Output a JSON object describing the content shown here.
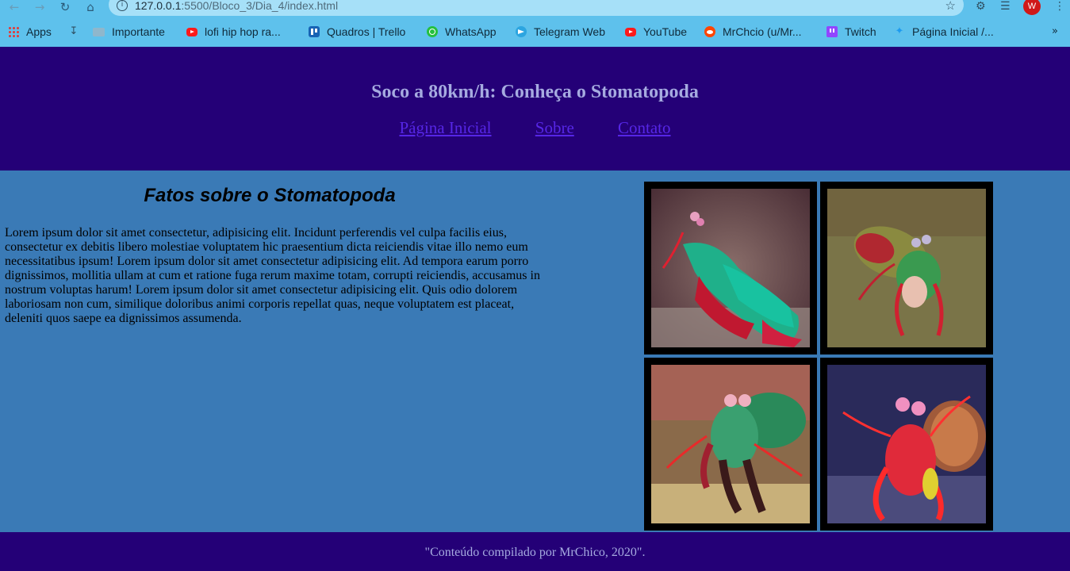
{
  "browser": {
    "url_host": "127.0.0.1",
    "url_rest": ":5500/Bloco_3/Dia_4/index.html",
    "profile_initial": "W",
    "bookmarks": [
      {
        "label": "Apps",
        "icon": "apps-grid-icon"
      },
      {
        "label": "",
        "icon": "download-icon"
      },
      {
        "label": "Importante",
        "icon": "folder-icon"
      },
      {
        "label": "lofi hip hop ra...",
        "icon": "youtube-icon"
      },
      {
        "label": "Quadros | Trello",
        "icon": "trello-icon"
      },
      {
        "label": "WhatsApp",
        "icon": "whatsapp-icon"
      },
      {
        "label": "Telegram Web",
        "icon": "telegram-icon"
      },
      {
        "label": "YouTube",
        "icon": "youtube-icon"
      },
      {
        "label": "MrChcio (u/Mr...",
        "icon": "reddit-icon"
      },
      {
        "label": "Twitch",
        "icon": "twitch-icon"
      },
      {
        "label": "Página Inicial /...",
        "icon": "twitter-icon"
      }
    ]
  },
  "header": {
    "title": "Soco a 80km/h: Conheça o Stomatopoda",
    "nav": [
      "Página Inicial",
      "Sobre",
      "Contato"
    ]
  },
  "main": {
    "heading": "Fatos sobre o Stomatopoda",
    "body": "Lorem ipsum dolor sit amet consectetur, adipisicing elit. Incidunt perferendis vel culpa facilis eius, consectetur ex debitis libero molestiae voluptatem hic praesentium dicta reiciendis vitae illo nemo eum necessitatibus ipsum! Lorem ipsum dolor sit amet consectetur adipisicing elit. Ad tempora earum porro dignissimos, mollitia ullam at cum et ratione fuga rerum maxime totam, corrupti reiciendis, accusamus in nostrum voluptas harum! Lorem ipsum dolor sit amet consectetur adipisicing elit. Quis odio dolorem laboriosam non cum, similique doloribus animi corporis repellat quas, neque voluptatem est placeat, deleniti quos saepe ea dignissimos assumenda."
  },
  "footer": {
    "text": "\"Conteúdo compilado por MrChico, 2020\"."
  },
  "colors": {
    "header_bg": "#240077",
    "page_bg": "#3a7ab6",
    "title_text": "#a6abe0",
    "link": "#5626e6",
    "browser_chrome": "#5ec1ec"
  }
}
